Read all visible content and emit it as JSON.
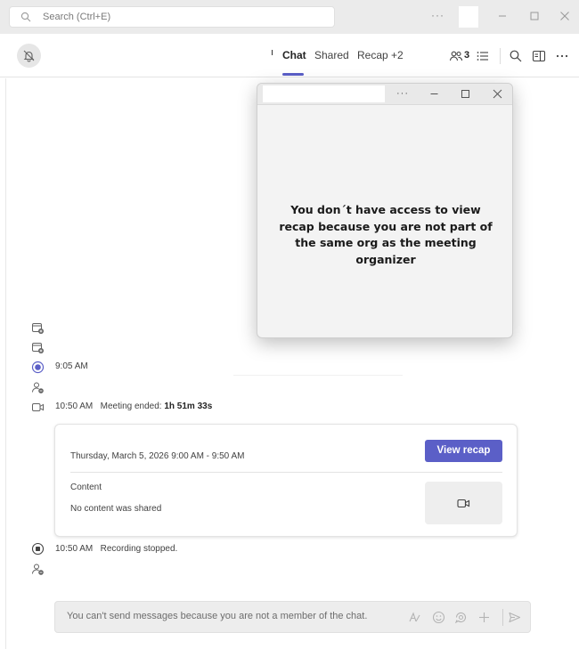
{
  "titlebar": {
    "search_placeholder": "Search (Ctrl+E)",
    "more_label": "···"
  },
  "header": {
    "tabs": [
      {
        "label": "Chat",
        "active": true
      },
      {
        "label": "Shared",
        "active": false
      },
      {
        "label": "Recap",
        "active": false
      },
      {
        "label": "+2",
        "active": false
      }
    ],
    "participants_count": "3"
  },
  "timeline": {
    "item_905_time": "9:05 AM",
    "meeting_ended_time": "10:50 AM",
    "meeting_ended_label": "Meeting ended:",
    "meeting_ended_duration": "1h 51m 33s",
    "recording_time": "10:50 AM",
    "recording_label": "Recording stopped."
  },
  "card": {
    "date_range": "Thursday, March 5, 2026 9:00 AM - 9:50 AM",
    "view_recap_label": "View recap",
    "content_label": "Content",
    "no_content_label": "No content was shared"
  },
  "compose": {
    "placeholder": "You can't send messages because you are not a member of the chat."
  },
  "popup": {
    "more_label": "···",
    "message": "You don´t have access to view recap because you are not part of the same org as the meeting organizer"
  },
  "colors": {
    "accent": "#5b5fc7",
    "titlebar_bg": "#ebebeb",
    "popup_bg": "#f3f3f3"
  }
}
